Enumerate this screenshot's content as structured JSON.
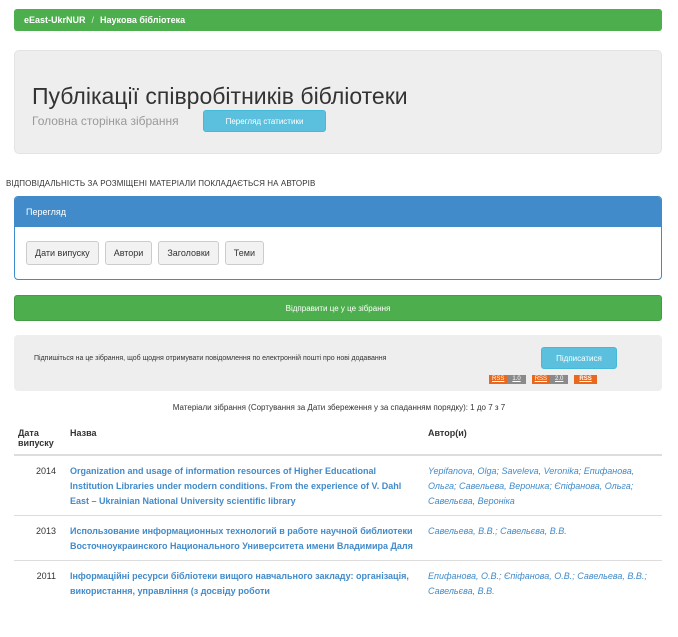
{
  "breadcrumb": {
    "home": "eEast-UkrNUR",
    "separator": "/",
    "current": "Наукова бібліотека"
  },
  "header": {
    "title": "Публікації співробітників бібліотеки",
    "subtitle": "Головна сторінка зібрання",
    "stats_button": "Перегляд статистики"
  },
  "notice": "ВІДПОВІДАЛЬНІСТЬ ЗА РОЗМІЩЕНІ МАТЕРІАЛИ ПОКЛАДАЄТЬСЯ НА АВТОРІВ",
  "browse": {
    "heading": "Перегляд",
    "buttons": [
      "Дати випуску",
      "Автори",
      "Заголовки",
      "Теми"
    ]
  },
  "export_button": "Відправити це у це зібрання",
  "subscribe": {
    "text": "Підпишіться на це зібрання, щоб щодня отримувати повідомлення по електронній пошті про нові додавання",
    "button": "Підписатися",
    "feeds": [
      {
        "left": "RSS",
        "right": "1.0"
      },
      {
        "left": "RSS",
        "right": "2.0"
      }
    ],
    "rss_label": "RSS",
    "accent_color": "#e8681d"
  },
  "items": {
    "caption": "Матеріали зібрання (Сортування за Дати збереження у за спаданням порядку): 1 до 7 з 7",
    "columns": [
      "Дата випуску",
      "Назва",
      "Автор(и)"
    ],
    "rows": [
      {
        "year": "2014",
        "title": "Organization and usage of information resources of Higher Educational Institution Libraries under modern conditions. From the experience of V. Dahl East – Ukrainian National University scientific library",
        "authors": "Yepifanova, Olga; Saveleva, Veronika; Епифанова, Ольга; Савельева, Вероника; Єпіфанова, Ольга; Савельєва, Вероніка"
      },
      {
        "year": "2013",
        "title": "Использование информационных технологий в работе научной библиотеки Восточноукраинского Национального Университета имени Владимира Даля",
        "authors": "Савельева, В.В.; Савельєва, В.В."
      },
      {
        "year": "2011",
        "title": "Інформаційні ресурси бібліотеки вищого навчального закладу: організація, використання, управління (з досвіду роботи",
        "authors": "Епифанова, О.В.; Єпіфанова, О.В.; Савельева, В.В.; Савельєва, В.В."
      }
    ]
  },
  "colors": {
    "green": "#4cae4c",
    "blue": "#428bca",
    "info": "#5bc0de",
    "link": "#428bca"
  }
}
